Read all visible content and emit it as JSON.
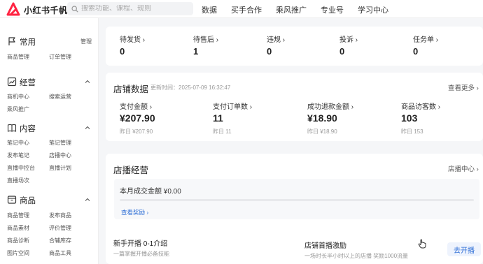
{
  "brand": {
    "name": "小红书千帆",
    "accent": "#ff2442"
  },
  "search": {
    "placeholder": "搜索功能、课程、规则"
  },
  "topnav": [
    "数据",
    "买手合作",
    "乘风推广",
    "专业号",
    "学习中心"
  ],
  "sidebar": {
    "common": {
      "title": "常用",
      "right_label": "管理",
      "items": [
        "商品管理",
        "订单管理"
      ]
    },
    "operate": {
      "title": "经营",
      "items": [
        "商机中心",
        "搜索运营",
        "乘风推广"
      ]
    },
    "content": {
      "title": "内容",
      "items": [
        "笔记中心",
        "笔记管理",
        "发布笔记",
        "店播中心",
        "直播中控台",
        "直播计划",
        "直播场次"
      ]
    },
    "goods": {
      "title": "商品",
      "items": [
        "商品管理",
        "发布商品",
        "商品素材",
        "评价管理",
        "商品诊断",
        "合辅库存",
        "图片空间",
        "商品工具"
      ]
    }
  },
  "todo": [
    {
      "label": "待发货",
      "value": "0"
    },
    {
      "label": "待售后",
      "value": "1"
    },
    {
      "label": "违规",
      "value": "0"
    },
    {
      "label": "投诉",
      "value": "0"
    },
    {
      "label": "任务单",
      "value": "0"
    }
  ],
  "store_data": {
    "title": "店铺数据",
    "updated": "更新时间：2025-07-09 16:32:47",
    "more": "查看更多",
    "metrics": [
      {
        "label": "支付金额",
        "value": "¥207.90",
        "yesterday": "昨日 ¥207.90"
      },
      {
        "label": "支付订单数",
        "value": "11",
        "yesterday": "昨日 11"
      },
      {
        "label": "成功退款金额",
        "value": "¥18.90",
        "yesterday": "昨日 ¥18.90"
      },
      {
        "label": "商品访客数",
        "value": "103",
        "yesterday": "昨日 153"
      }
    ]
  },
  "live": {
    "title": "店播经营",
    "center_link": "店播中心",
    "month_deal": "本月成交金额 ¥0.00",
    "progress": 0,
    "view_reward": "查看奖励",
    "newbie_title": "新手开播 0-1介绍",
    "newbie_sub": "一篇掌握开播必备技能",
    "first_title": "店铺首播激励",
    "first_sub": "一场时长半小时以上的店播 奖励1000流量",
    "start_button": "去开播"
  }
}
